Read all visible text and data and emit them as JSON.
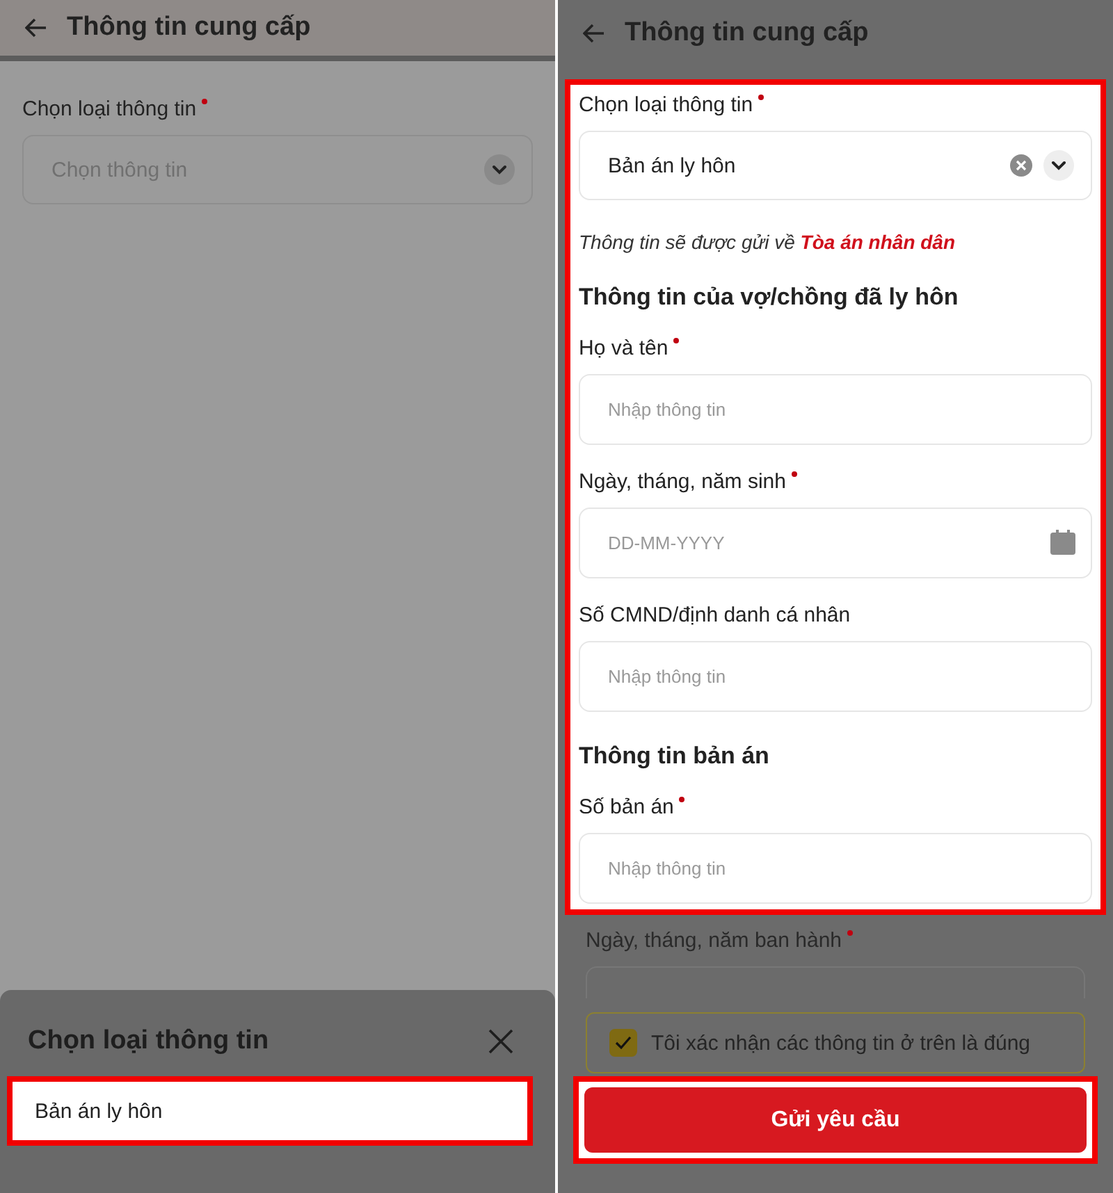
{
  "left_screen": {
    "title": "Thông tin cung cấp",
    "form": {
      "label": "Chọn loại thông tin",
      "required": true,
      "placeholder": "Chọn thông tin"
    },
    "sheet": {
      "title": "Chọn loại thông tin",
      "options": [
        {
          "label": "Bản án ly hôn",
          "highlighted": true
        }
      ]
    }
  },
  "right_screen": {
    "title": "Thông tin cung cấp",
    "highlighted": true,
    "select_field": {
      "label": "Chọn loại thông tin",
      "required": true,
      "value": "Bản án ly hôn"
    },
    "notice": "Thông tin sẽ được gửi về **Tòa án nhân dân**",
    "sections": [
      {
        "heading": "Thông tin của vợ/chồng đã ly hôn",
        "fields": [
          {
            "label": "Họ và tên",
            "required": true,
            "placeholder": "Nhập thông tin",
            "kind": "text"
          },
          {
            "label": "Ngày, tháng, năm sinh",
            "required": true,
            "placeholder": "DD-MM-YYYY",
            "kind": "date"
          },
          {
            "label": "Số CMND/định danh cá nhân",
            "required": false,
            "placeholder": "Nhập thông tin",
            "kind": "text"
          }
        ]
      },
      {
        "heading": "Thông tin bản án",
        "fields": [
          {
            "label": "Số bản án",
            "required": true,
            "placeholder": "Nhập thông tin",
            "kind": "text"
          }
        ]
      }
    ],
    "dimmed_field": {
      "label": "Ngày, tháng, năm ban hành",
      "required": true
    },
    "confirm": {
      "label": "Tôi xác nhận các thông tin ở trên là đúng",
      "checked": true
    },
    "submit_button": {
      "label": "Gửi yêu cầu",
      "highlighted": true
    }
  }
}
